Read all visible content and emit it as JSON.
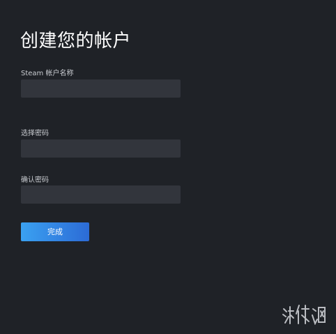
{
  "page": {
    "title": "创建您的帐户"
  },
  "form": {
    "account_name_label": "Steam 帐户名称",
    "account_name_value": "",
    "password_label": "选择密码",
    "password_value": "",
    "confirm_password_label": "确认密码",
    "confirm_password_value": "",
    "submit_label": "完成"
  },
  "watermark": {
    "text": "游侠网"
  },
  "colors": {
    "background": "#1f2227",
    "input_background": "#32353c",
    "button_gradient_start": "#3aa1f1",
    "button_gradient_end": "#2c6bd6"
  }
}
